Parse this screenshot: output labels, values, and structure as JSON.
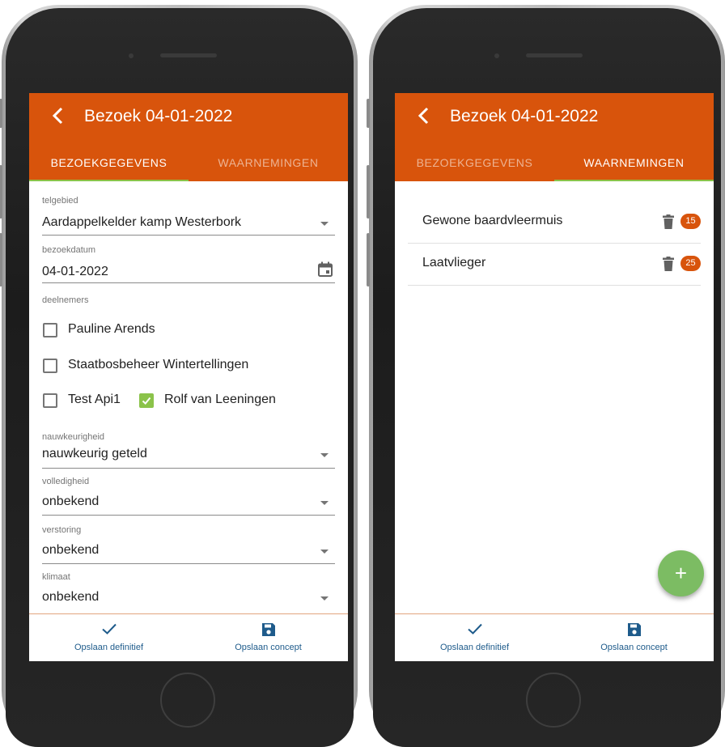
{
  "colors": {
    "accent": "#d8540c",
    "tab_indicator": "#8bc34a",
    "fab": "#7cbc63",
    "bottom_text": "#1e5b8b"
  },
  "header": {
    "title": "Bezoek 04-01-2022"
  },
  "tabs": [
    {
      "label": "BEZOEKGEGEVENS"
    },
    {
      "label": "WAARNEMINGEN"
    }
  ],
  "form": {
    "telgebied": {
      "label": "telgebied",
      "value": "Aardappelkelder kamp Westerbork"
    },
    "bezoekdatum": {
      "label": "bezoekdatum",
      "value": "04-01-2022",
      "icon": "calendar-icon"
    },
    "deelnemers": {
      "label": "deelnemers",
      "items": [
        {
          "name": "Pauline Arends",
          "checked": false
        },
        {
          "name": "Staatbosbeheer Wintertellingen",
          "checked": false
        },
        {
          "name": "Test Api1",
          "checked": false
        },
        {
          "name": "Rolf van Leeningen",
          "checked": true
        }
      ]
    },
    "nauwkeurigheid": {
      "label": "nauwkeurigheid",
      "value": "nauwkeurig geteld"
    },
    "volledigheid": {
      "label": "volledigheid",
      "value": "onbekend"
    },
    "verstoring": {
      "label": "verstoring",
      "value": "onbekend"
    },
    "klimaat": {
      "label": "klimaat",
      "value": "onbekend"
    }
  },
  "observations": [
    {
      "species": "Gewone baardvleermuis",
      "count": "15"
    },
    {
      "species": "Laatvlieger",
      "count": "25"
    }
  ],
  "fab": {
    "label": "+"
  },
  "bottom": {
    "final_label": "Opslaan definitief",
    "concept_label": "Opslaan concept"
  }
}
